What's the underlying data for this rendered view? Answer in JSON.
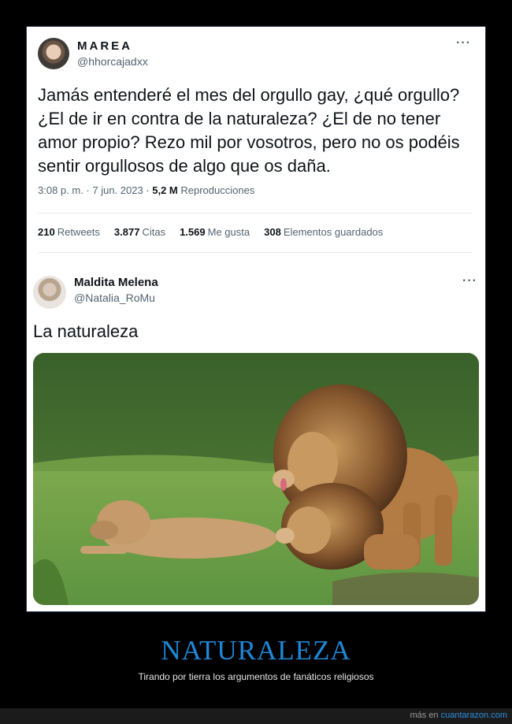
{
  "tweet1": {
    "display_name": "MAREA",
    "handle": "@hhorcajadxx",
    "more": "···",
    "text": "Jamás entenderé el mes del orgullo gay, ¿qué orgullo? ¿El de ir en contra de la naturaleza? ¿El de no tener amor propio? Rezo mil por vosotros, pero no os podéis sentir orgullosos de algo que os daña.",
    "timestamp": "3:08 p. m. · 7 jun. 2023 · ",
    "views_value": "5,2 M",
    "views_label": " Reproducciones",
    "stats": {
      "retweets_value": "210",
      "retweets_label": "Retweets",
      "quotes_value": "3.877",
      "quotes_label": "Citas",
      "likes_value": "1.569",
      "likes_label": "Me gusta",
      "bookmarks_value": "308",
      "bookmarks_label": "Elementos guardados"
    }
  },
  "tweet2": {
    "display_name": "Maldita Melena",
    "handle": "@Natalia_RoMu",
    "more": "···",
    "text": "La naturaleza"
  },
  "caption": {
    "title": "NATURALEZA",
    "subtitle": "Tirando por tierra los argumentos de fanáticos religiosos"
  },
  "footer": {
    "prefix": "más en ",
    "site": "cuantarazon.com"
  },
  "colors": {
    "title_blue": "#1e88d8",
    "link_blue": "#2e8fe0",
    "text_dark": "#0f1419",
    "text_gray": "#536471"
  }
}
